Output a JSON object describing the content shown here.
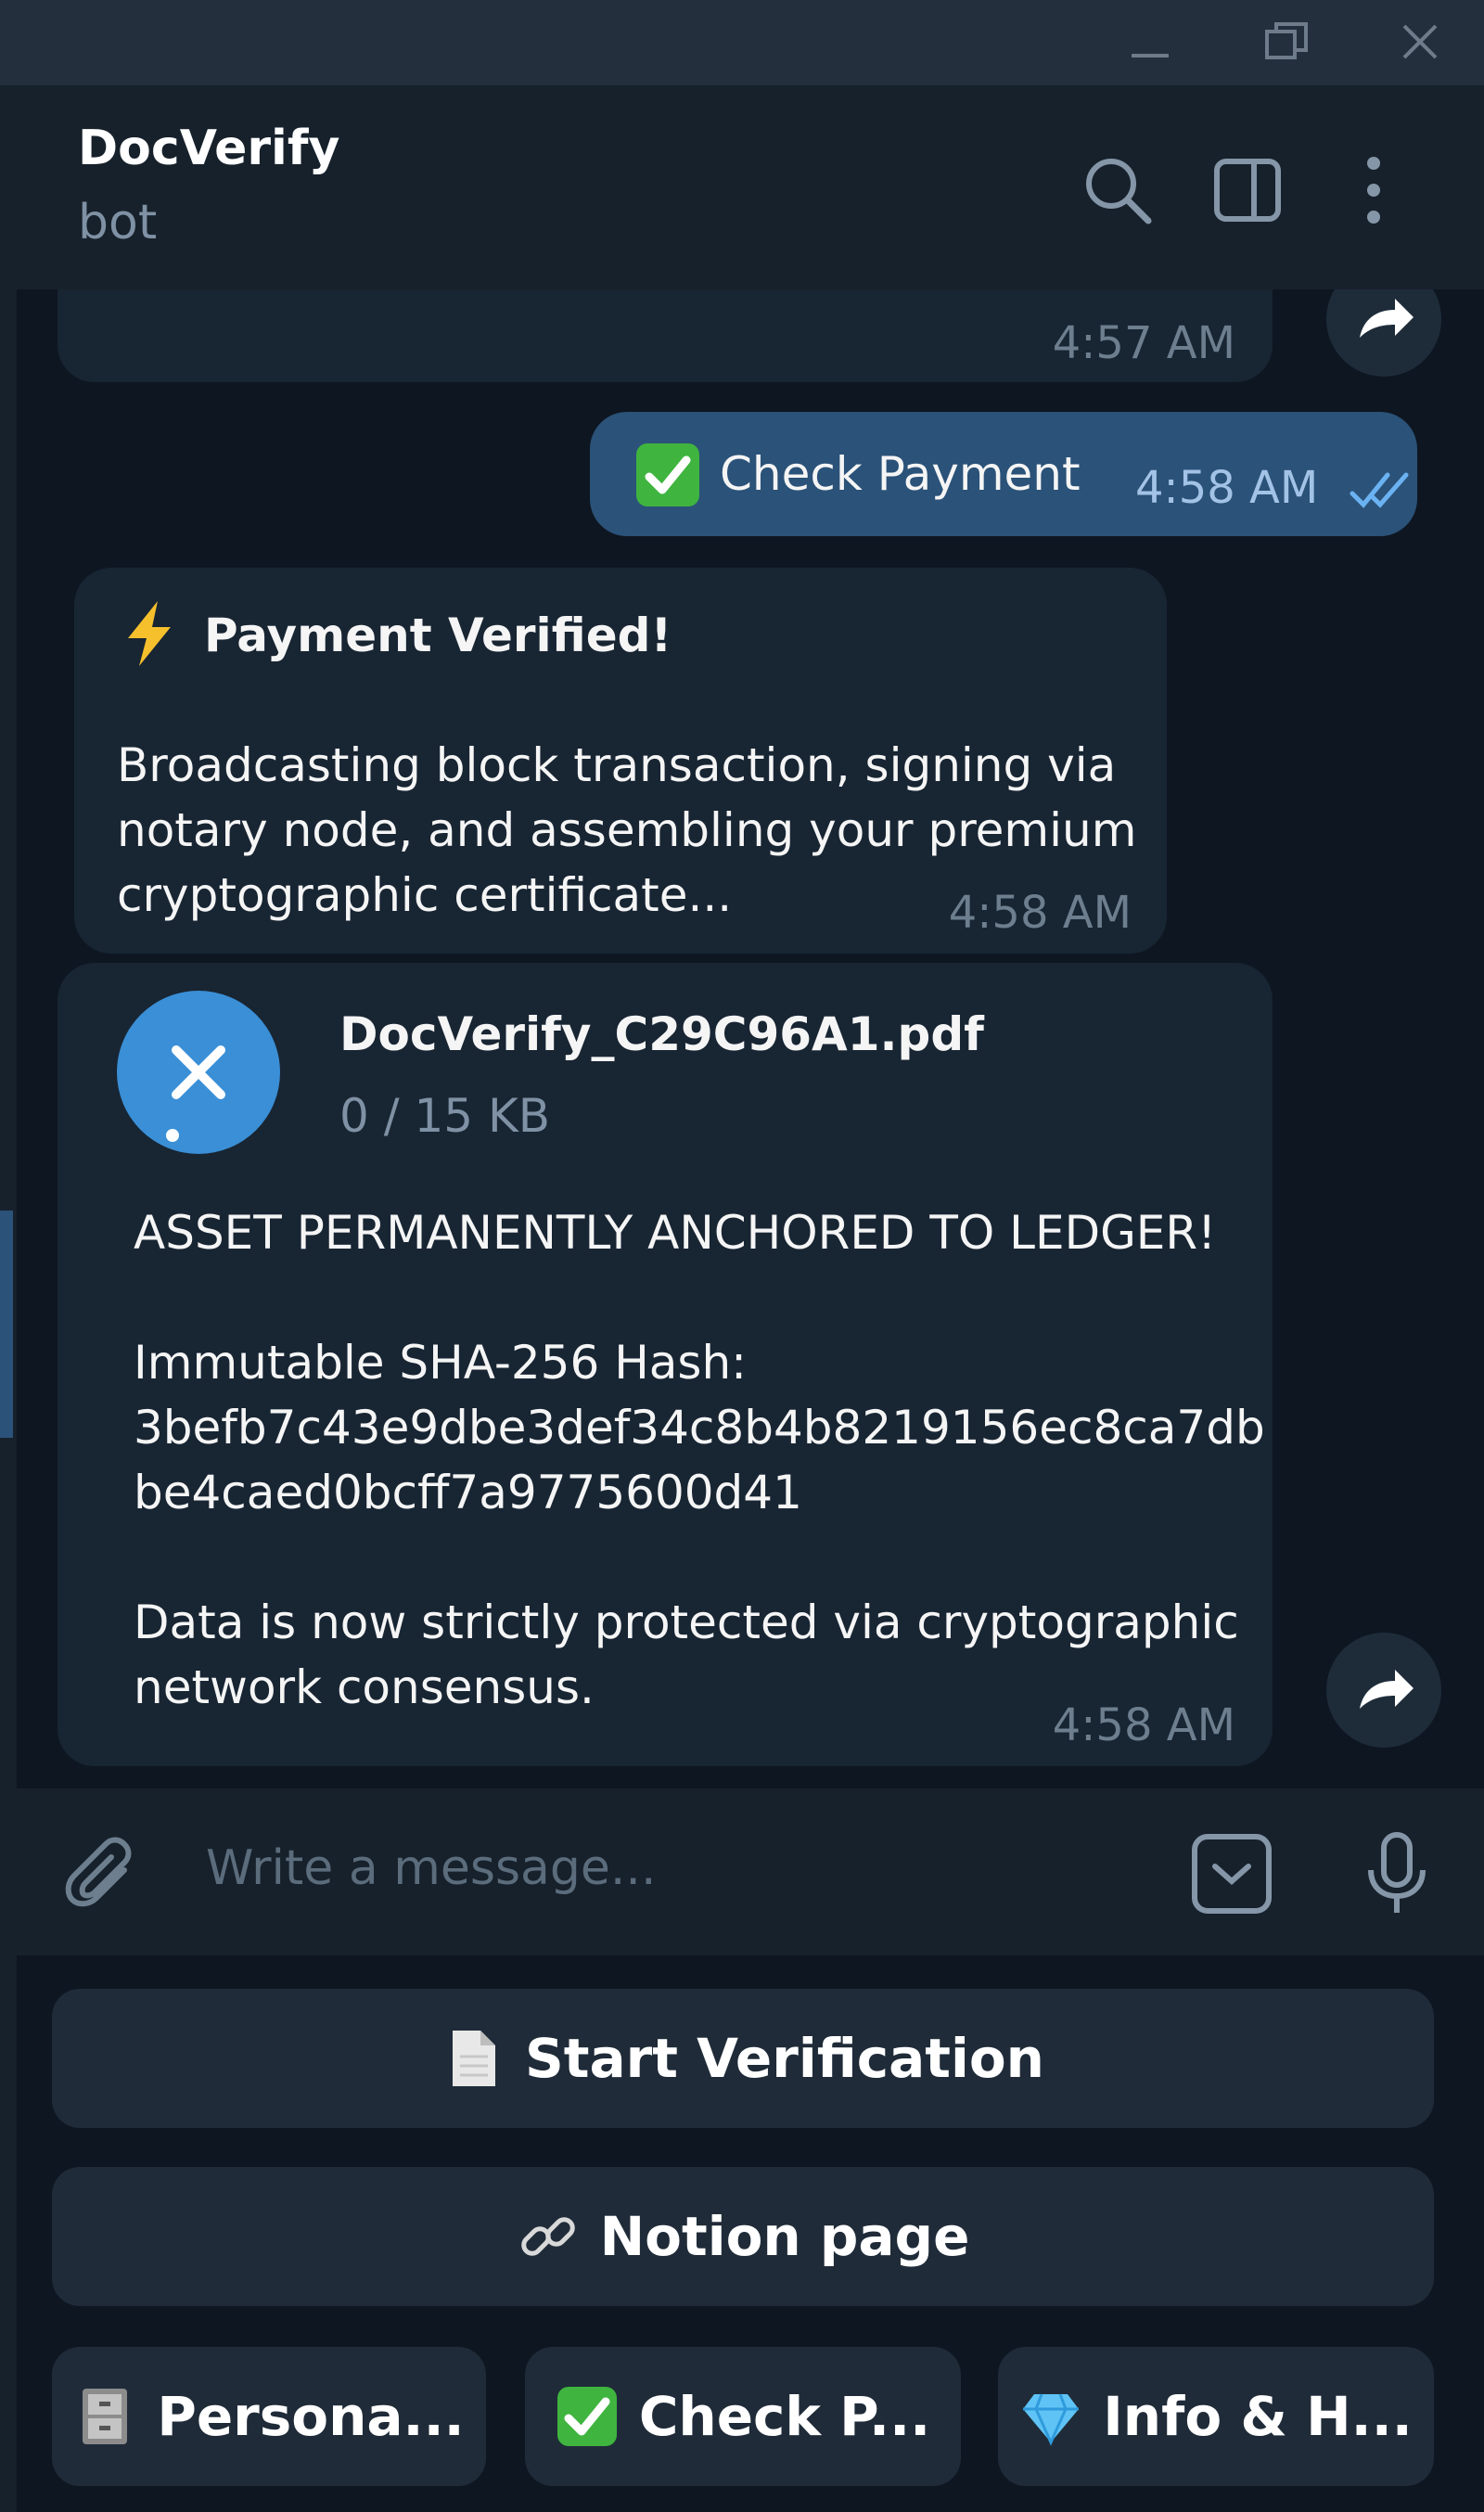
{
  "window": {
    "minimize_icon": "minimize-icon",
    "restore_icon": "restore-icon",
    "close_icon": "close-icon"
  },
  "header": {
    "title": "DocVerify",
    "subtitle": "bot"
  },
  "messages": {
    "prev_time": "4:57 AM",
    "out_text": "Check Payment",
    "out_time": "4:58 AM",
    "verified_title": "Payment Verified!",
    "verified_body": "Broadcasting block transaction, signing via\nnotary node, and assembling your premium\ncryptographic certificate...",
    "verified_time": "4:58 AM",
    "file_name": "DocVerify_C29C96A1.pdf",
    "file_size": "0 / 15 KB",
    "anchored": "ASSET PERMANENTLY ANCHORED TO LEDGER!",
    "hash_label": "Immutable SHA-256 Hash:",
    "hash_value": "3befb7c43e9dbe3def34c8b4b8219156ec8ca7db\nbe4caed0bcff7a9775600d41",
    "protected": "Data is now strictly protected via cryptographic\nnetwork consensus.",
    "file_time": "4:58 AM"
  },
  "composer": {
    "placeholder": "Write a message..."
  },
  "keyboard": {
    "start": "Start Verification",
    "notion": "Notion page",
    "personal": "Persona...",
    "check": "Check P...",
    "info": "Info & H..."
  },
  "colors": {
    "accent": "#2b5278",
    "background": "#0e1621",
    "bubble_in": "#182533",
    "check_green": "#3fb43f"
  }
}
